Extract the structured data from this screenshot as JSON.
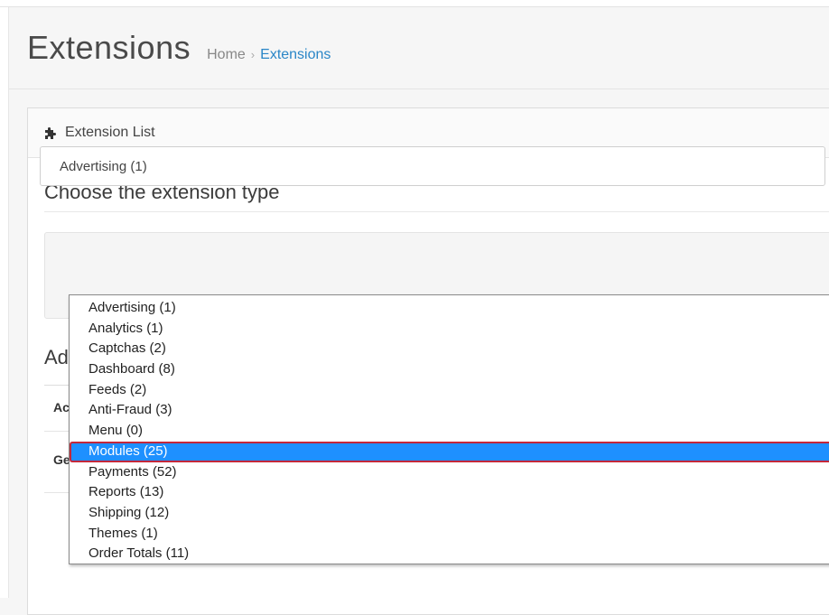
{
  "header": {
    "title": "Extensions",
    "breadcrumb": {
      "home": "Home",
      "separator": "›",
      "current": "Extensions"
    }
  },
  "panel": {
    "icon": "puzzle-icon",
    "title": "Extension List"
  },
  "chooser": {
    "heading": "Choose the extension type",
    "selected_value": "Advertising (1)",
    "options": [
      "Advertising (1)",
      "Analytics (1)",
      "Captchas (2)",
      "Dashboard (8)",
      "Feeds (2)",
      "Anti-Fraud (3)",
      "Menu (0)",
      "Modules (25)",
      "Payments (52)",
      "Reports (13)",
      "Shipping (12)",
      "Themes (1)",
      "Order Totals (11)"
    ],
    "highlighted_option": "Modules (25)"
  },
  "obscured": {
    "heading_fragment": "Ad",
    "row1_fragment": "Ac",
    "row2_fragment": "Ge"
  },
  "colors": {
    "accent_link": "#2a86c7",
    "highlight": "#1e90ff",
    "highlight_border": "#c3273a"
  }
}
